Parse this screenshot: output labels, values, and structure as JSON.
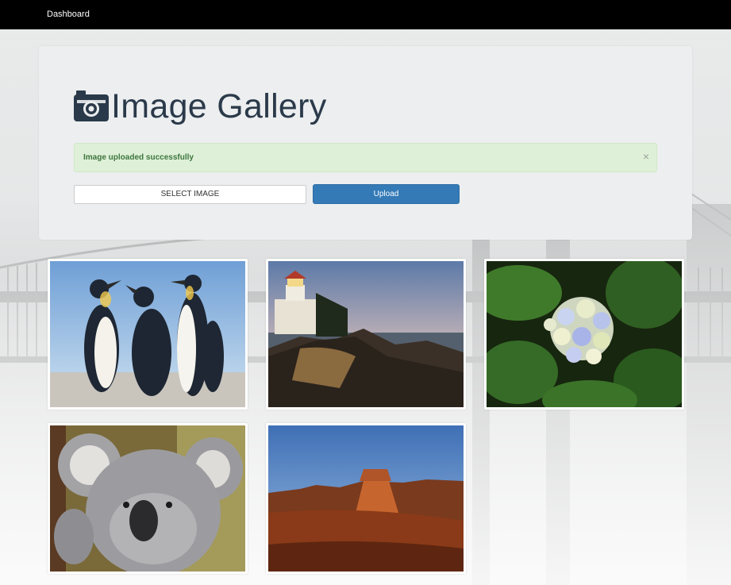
{
  "navbar": {
    "brand": "Dashboard"
  },
  "gallery": {
    "title": "Image Gallery",
    "title_icon": "camera-icon"
  },
  "alert": {
    "message": "Image uploaded successfully",
    "close": "×",
    "color": "#dff0d8"
  },
  "controls": {
    "select_label": "SELECT IMAGE",
    "upload_label": "Upload",
    "upload_color": "#337ab7"
  },
  "images": [
    {
      "subject": "penguins"
    },
    {
      "subject": "lighthouse"
    },
    {
      "subject": "hydrangea"
    },
    {
      "subject": "koala"
    },
    {
      "subject": "desert"
    }
  ]
}
